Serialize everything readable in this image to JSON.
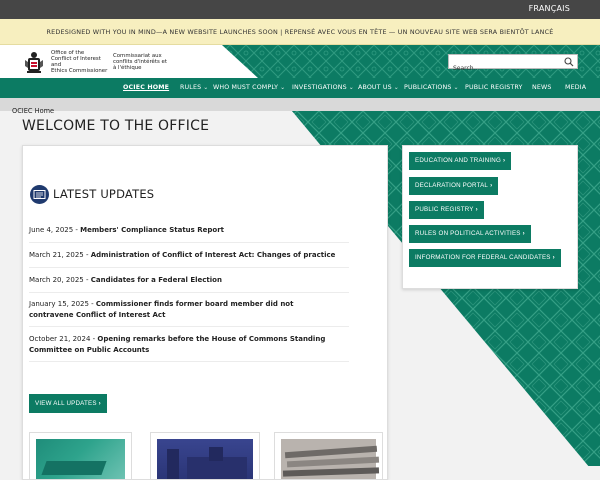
{
  "topbar": {
    "language_link": "FRANÇAIS"
  },
  "banner": {
    "text": "REDESIGNED WITH YOU IN MIND—A NEW WEBSITE LAUNCHES SOON | REPENSÉ AVEC VOUS EN TÊTE — UN NOUVEAU SITE WEB SERA BIENTÔT LANCÉ"
  },
  "header": {
    "logo_en_line1": "Office of the",
    "logo_en_line2": "Conflict of Interest and",
    "logo_en_line3": "Ethics Commissioner",
    "logo_fr_line1": "Commissariat aux",
    "logo_fr_line2": "conflits d'intérêts et",
    "logo_fr_line3": "à l'éthique",
    "search_placeholder": "Search..."
  },
  "nav": {
    "home": "OCIEC HOME",
    "rules": "RULES",
    "who": "WHO MUST COMPLY",
    "investigations": "INVESTIGATIONS",
    "about": "ABOUT US",
    "publications": "PUBLICATIONS",
    "registry": "PUBLIC REGISTRY",
    "news": "NEWS",
    "media": "MEDIA"
  },
  "breadcrumb": {
    "home": "OCIEC Home"
  },
  "main": {
    "title": "WELCOME TO THE OFFICE",
    "updates_heading": "LATEST UPDATES",
    "updates": [
      {
        "date": "June 4, 2025 - ",
        "title": "Members' Compliance Status Report"
      },
      {
        "date": "March 21, 2025 - ",
        "title": "Administration of Conflict of Interest Act: Changes of practice"
      },
      {
        "date": "March 20, 2025 - ",
        "title": "Candidates for a Federal Election"
      },
      {
        "date": "January 15, 2025 - ",
        "title": "Commissioner finds former board member did not contravene Conflict of Interest Act"
      },
      {
        "date": "October 21, 2024 - ",
        "title": "Opening remarks before the House of Commons Standing Committee on Public Accounts"
      }
    ],
    "view_all": "VIEW ALL UPDATES"
  },
  "quick_links": [
    "EDUCATION AND TRAINING",
    "DECLARATION PORTAL",
    "PUBLIC REGISTRY",
    "RULES ON POLITICAL ACTIVITIES",
    "INFORMATION FOR FEDERAL CANDIDATES"
  ],
  "colors": {
    "brand_green": "#0c7b63",
    "banner_yellow": "#f7efbf",
    "topbar_gray": "#464646"
  },
  "icons": {
    "search": "magnifier-icon",
    "updates": "newspaper-icon",
    "arrow": "chevron-right-icon",
    "logo": "canadian-coat-of-arms-icon"
  }
}
